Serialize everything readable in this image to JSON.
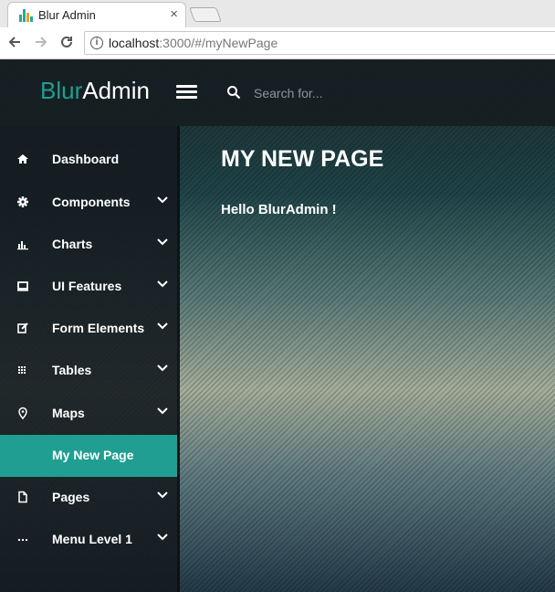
{
  "browser": {
    "tab_title": "Blur Admin",
    "tab_close": "×",
    "url_host": "localhost",
    "url_rest": ":3000/#/myNewPage"
  },
  "app": {
    "logo_part1": "Blur",
    "logo_part2": "Admin",
    "search_placeholder": "Search for...",
    "accent_color": "#209e91"
  },
  "sidebar": {
    "items": [
      {
        "label": "Dashboard",
        "icon": "home-icon",
        "expandable": false,
        "active": false
      },
      {
        "label": "Components",
        "icon": "gear-icon",
        "expandable": true,
        "active": false
      },
      {
        "label": "Charts",
        "icon": "bar-chart-icon",
        "expandable": true,
        "active": false
      },
      {
        "label": "UI Features",
        "icon": "laptop-icon",
        "expandable": true,
        "active": false
      },
      {
        "label": "Form Elements",
        "icon": "edit-icon",
        "expandable": true,
        "active": false
      },
      {
        "label": "Tables",
        "icon": "grid-icon",
        "expandable": true,
        "active": false
      },
      {
        "label": "Maps",
        "icon": "map-marker-icon",
        "expandable": true,
        "active": false
      },
      {
        "label": "My New Page",
        "icon": "",
        "expandable": false,
        "active": true
      },
      {
        "label": "Pages",
        "icon": "file-icon",
        "expandable": true,
        "active": false
      },
      {
        "label": "Menu Level 1",
        "icon": "ellipsis-icon",
        "expandable": true,
        "active": false
      }
    ]
  },
  "main": {
    "title": "MY NEW PAGE",
    "body": "Hello BlurAdmin !"
  }
}
